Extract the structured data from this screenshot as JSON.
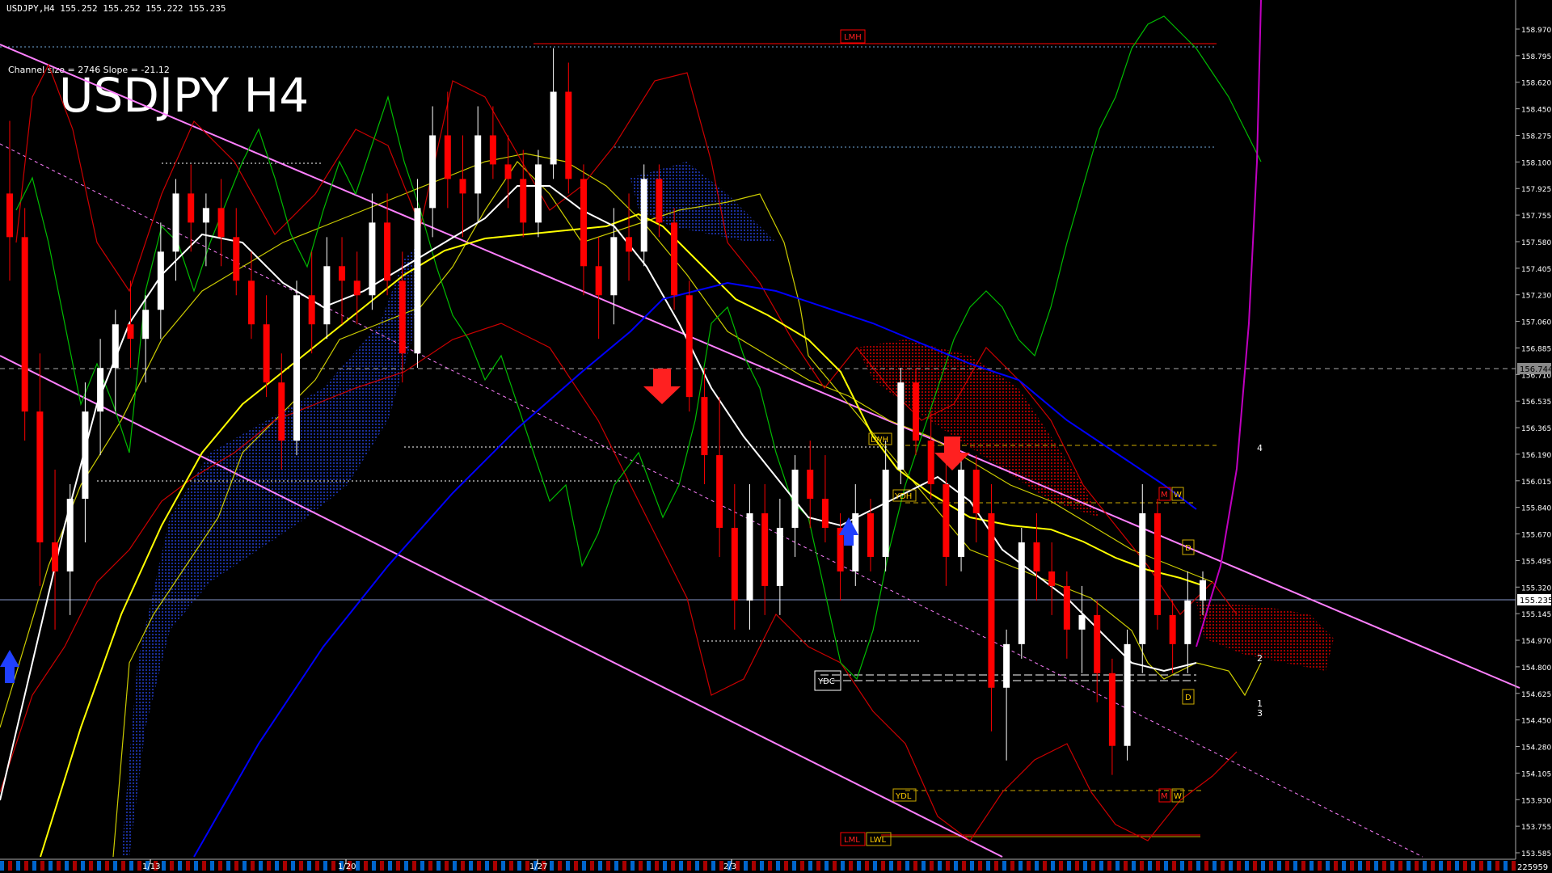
{
  "header": {
    "symbol_info": "USDJPY,H4  155.252 155.252 155.222 155.235",
    "channel_info": "Channel size = 2746 Slope = -21.12",
    "big_title": "USDJPY H4"
  },
  "colors": {
    "bull": "#ffffff",
    "bear": "#ff0000",
    "ma_yellow": "#ffff00",
    "ma_blue": "#0000ff",
    "channel": "#ff80ff",
    "envelope": "#ff0000",
    "ichimoku": "#ffff00",
    "green_line": "#00cc00",
    "magenta": "#c000c0",
    "cloud": "#0a1a6e",
    "cloud_red": "#9a0000",
    "grid_line": "#6fa8dc"
  },
  "chart_data": {
    "type": "candlestick",
    "title": "USDJPY H4",
    "ylim": [
      153.42,
      159.12
    ],
    "y_ticks": [
      "158.970",
      "158.795",
      "158.620",
      "158.450",
      "158.275",
      "158.100",
      "157.925",
      "157.755",
      "157.580",
      "157.405",
      "157.230",
      "157.060",
      "156.885",
      "156.710",
      "156.535",
      "156.365",
      "156.190",
      "156.015",
      "155.840",
      "155.670",
      "155.495",
      "155.320",
      "155.145",
      "154.970",
      "154.800",
      "154.625",
      "154.450",
      "154.280",
      "154.105",
      "153.930",
      "153.755",
      "153.585"
    ],
    "current_price": "155.235",
    "marked_level": "156.744",
    "x_ticks": [
      "1/13",
      "1/20",
      "1/27",
      "2/3"
    ],
    "corner_label": "225959",
    "level_labels": [
      "LMH",
      "LWH",
      "YDH",
      "YDC",
      "YDL",
      "LML",
      "LWL",
      "M",
      "W",
      "D"
    ],
    "projection_labels": [
      "4",
      "2",
      "1",
      "3"
    ],
    "candles": [
      [
        157.9,
        158.4,
        157.3,
        157.6
      ],
      [
        157.6,
        157.8,
        156.2,
        156.4
      ],
      [
        156.4,
        156.8,
        155.2,
        155.5
      ],
      [
        155.5,
        156.0,
        154.9,
        155.3
      ],
      [
        155.3,
        155.9,
        155.0,
        155.8
      ],
      [
        155.8,
        156.6,
        155.5,
        156.4
      ],
      [
        156.4,
        156.9,
        156.1,
        156.7
      ],
      [
        156.7,
        157.1,
        156.4,
        157.0
      ],
      [
        157.0,
        157.3,
        156.7,
        156.9
      ],
      [
        156.9,
        157.2,
        156.6,
        157.1
      ],
      [
        157.1,
        157.7,
        156.9,
        157.5
      ],
      [
        157.5,
        158.0,
        157.3,
        157.9
      ],
      [
        157.9,
        158.1,
        157.5,
        157.7
      ],
      [
        157.7,
        157.9,
        157.4,
        157.8
      ],
      [
        157.8,
        158.0,
        157.4,
        157.6
      ],
      [
        157.6,
        157.8,
        157.2,
        157.3
      ],
      [
        157.3,
        157.5,
        156.9,
        157.0
      ],
      [
        157.0,
        157.2,
        156.5,
        156.6
      ],
      [
        156.6,
        156.8,
        156.0,
        156.2
      ],
      [
        156.2,
        157.3,
        156.1,
        157.2
      ],
      [
        157.2,
        157.5,
        156.8,
        157.0
      ],
      [
        157.0,
        157.6,
        156.9,
        157.4
      ],
      [
        157.4,
        157.6,
        157.0,
        157.3
      ],
      [
        157.3,
        157.5,
        157.0,
        157.2
      ],
      [
        157.2,
        157.9,
        157.1,
        157.7
      ],
      [
        157.7,
        157.9,
        157.2,
        157.3
      ],
      [
        157.3,
        157.5,
        156.6,
        156.8
      ],
      [
        156.8,
        158.0,
        156.7,
        157.8
      ],
      [
        157.8,
        158.5,
        157.6,
        158.3
      ],
      [
        158.3,
        158.6,
        157.8,
        158.0
      ],
      [
        158.0,
        158.3,
        157.6,
        157.9
      ],
      [
        157.9,
        158.5,
        157.7,
        158.3
      ],
      [
        158.3,
        158.5,
        158.0,
        158.1
      ],
      [
        158.1,
        158.3,
        157.8,
        158.0
      ],
      [
        158.0,
        158.2,
        157.6,
        157.7
      ],
      [
        157.7,
        158.2,
        157.6,
        158.1
      ],
      [
        158.1,
        158.9,
        158.0,
        158.6
      ],
      [
        158.6,
        158.8,
        157.9,
        158.0
      ],
      [
        158.0,
        158.1,
        157.2,
        157.4
      ],
      [
        157.4,
        157.6,
        156.9,
        157.2
      ],
      [
        157.2,
        157.8,
        157.0,
        157.6
      ],
      [
        157.6,
        157.9,
        157.3,
        157.5
      ],
      [
        157.5,
        158.1,
        157.4,
        158.0
      ],
      [
        158.0,
        158.1,
        157.6,
        157.7
      ],
      [
        157.7,
        157.8,
        157.1,
        157.2
      ],
      [
        157.2,
        157.3,
        156.4,
        156.5
      ],
      [
        156.5,
        156.7,
        155.9,
        156.1
      ],
      [
        156.1,
        156.5,
        155.4,
        155.6
      ],
      [
        155.6,
        155.9,
        154.9,
        155.1
      ],
      [
        155.1,
        155.9,
        154.9,
        155.7
      ],
      [
        155.7,
        155.9,
        155.0,
        155.2
      ],
      [
        155.2,
        155.8,
        155.0,
        155.6
      ],
      [
        155.6,
        156.1,
        155.4,
        156.0
      ],
      [
        156.0,
        156.2,
        155.6,
        155.8
      ],
      [
        155.8,
        156.1,
        155.5,
        155.6
      ],
      [
        155.6,
        155.7,
        155.1,
        155.3
      ],
      [
        155.3,
        155.9,
        155.2,
        155.7
      ],
      [
        155.7,
        155.8,
        155.3,
        155.4
      ],
      [
        155.4,
        156.2,
        155.3,
        156.0
      ],
      [
        156.0,
        156.7,
        155.9,
        156.6
      ],
      [
        156.6,
        156.7,
        156.1,
        156.2
      ],
      [
        156.2,
        156.4,
        155.8,
        155.9
      ],
      [
        155.9,
        156.1,
        155.2,
        155.4
      ],
      [
        155.4,
        156.1,
        155.3,
        156.0
      ],
      [
        156.0,
        156.1,
        155.5,
        155.7
      ],
      [
        155.7,
        155.9,
        154.2,
        154.5
      ],
      [
        154.5,
        154.9,
        154.0,
        154.8
      ],
      [
        154.8,
        155.6,
        154.7,
        155.5
      ],
      [
        155.5,
        155.7,
        155.1,
        155.3
      ],
      [
        155.3,
        155.5,
        155.0,
        155.2
      ],
      [
        155.2,
        155.3,
        154.7,
        154.9
      ],
      [
        154.9,
        155.2,
        154.6,
        155.0
      ],
      [
        155.0,
        155.1,
        154.4,
        154.6
      ],
      [
        154.6,
        154.7,
        153.9,
        154.1
      ],
      [
        154.1,
        154.9,
        154.0,
        154.8
      ],
      [
        154.8,
        155.9,
        154.6,
        155.7
      ],
      [
        155.7,
        155.8,
        154.9,
        155.0
      ],
      [
        155.0,
        155.1,
        154.6,
        154.8
      ],
      [
        154.8,
        155.3,
        154.6,
        155.1
      ],
      [
        155.1,
        155.3,
        155.0,
        155.24
      ]
    ]
  }
}
